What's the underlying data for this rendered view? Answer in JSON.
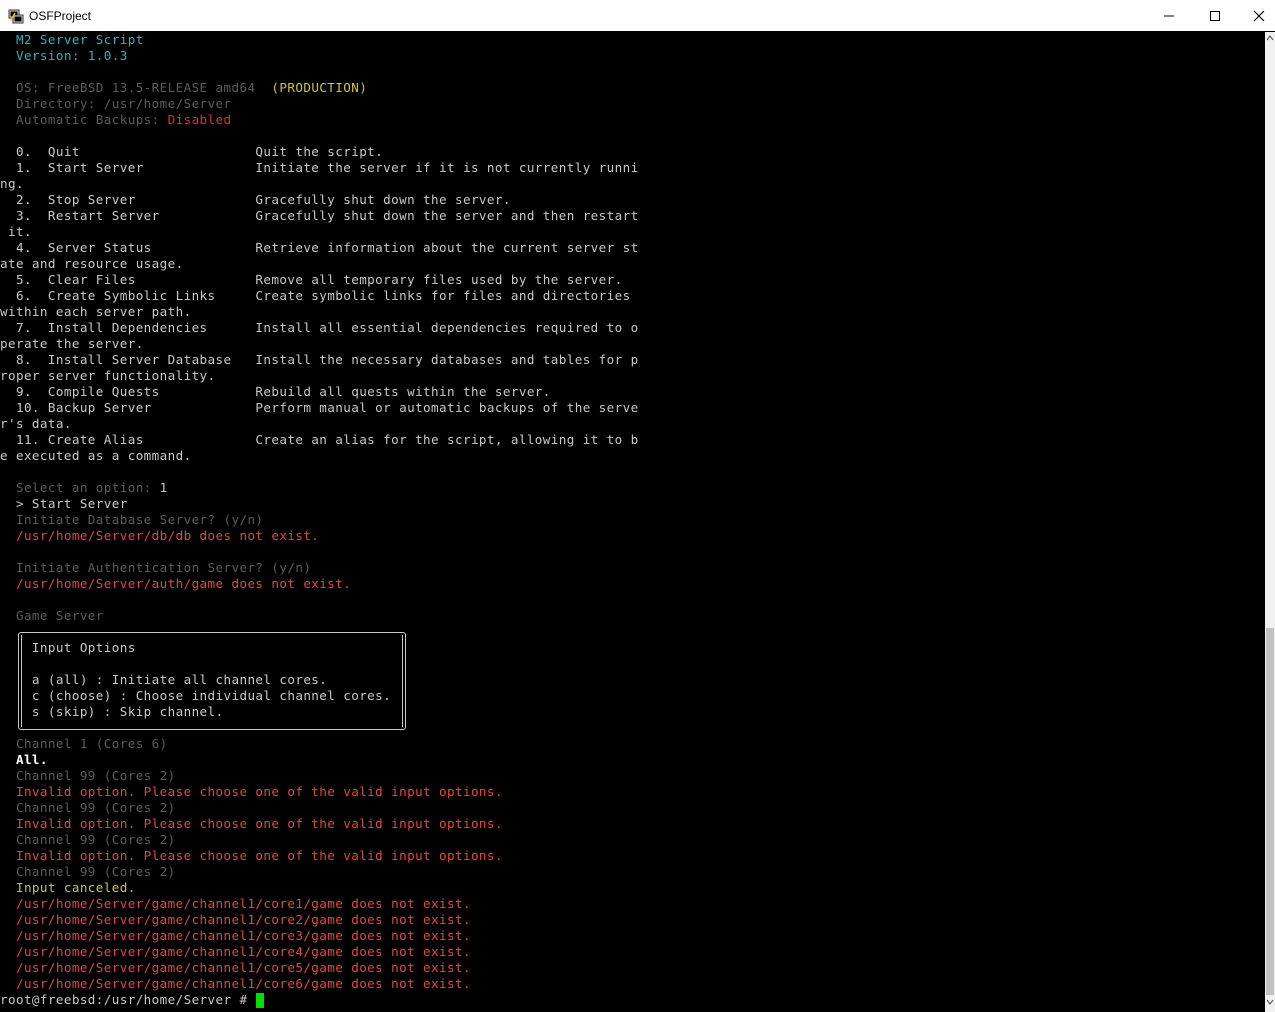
{
  "window": {
    "title": "OSFProject",
    "icon": "putty-icon",
    "controls": [
      "minimize-icon",
      "maximize-icon",
      "close-icon"
    ]
  },
  "colors": {
    "background": "#000000",
    "header": "#2ab6c0",
    "muted": "#5c5c5c",
    "error": "#e0302a",
    "warning": "#c8c83c",
    "text": "#c0c0c0",
    "cursor": "#00e000"
  },
  "terminal": {
    "header_title": "  M2 Server Script",
    "header_version": "  Version: 1.0.3",
    "os_info": "  OS: FreeBSD 13.5-RELEASE amd64",
    "os_env": "(PRODUCTION)",
    "directory": "  Directory: /usr/home/Server",
    "backups_label": "  Automatic Backups: ",
    "backups_value": "Disabled",
    "menu_lines": [
      "  0.  Quit                      Quit the script.",
      "  1.  Start Server              Initiate the server if it is not currently runni",
      "ng.",
      "  2.  Stop Server               Gracefully shut down the server.",
      "  3.  Restart Server            Gracefully shut down the server and then restart",
      " it.",
      "  4.  Server Status             Retrieve information about the current server st",
      "ate and resource usage.",
      "  5.  Clear Files               Remove all temporary files used by the server.",
      "  6.  Create Symbolic Links     Create symbolic links for files and directories",
      "within each server path.",
      "  7.  Install Dependencies      Install all essential dependencies required to o",
      "perate the server.",
      "  8.  Install Server Database   Install the necessary databases and tables for p",
      "roper server functionality.",
      "  9.  Compile Quests            Rebuild all quests within the server.",
      "  10. Backup Server             Perform manual or automatic backups of the serve",
      "r's data.",
      "  11. Create Alias              Create an alias for the script, allowing it to b",
      "e executed as a command."
    ],
    "select_prompt": "  Select an option: ",
    "select_value": "1",
    "selected_echo": "  > Start Server",
    "db_prompt": "  Initiate Database Server? (y/n)",
    "db_error": "  /usr/home/Server/db/db does not exist.",
    "auth_prompt": "  Initiate Authentication Server? (y/n)",
    "auth_error": "  /usr/home/Server/auth/game does not exist.",
    "game_server": "  Game Server",
    "input_options_title": "    Input Options",
    "input_options": [
      "    a (all) : Initiate all channel cores.",
      "    c (choose) : Choose individual channel cores.",
      "    s (skip) : Skip channel."
    ],
    "channel1": "  Channel 1 (Cores 6)",
    "all_answer": "  All.",
    "channel99": "  Channel 99 (Cores 2)",
    "invalid": "  Invalid option. Please choose one of the valid input options.",
    "canceled": "  Input canceled.",
    "core_errors": [
      "  /usr/home/Server/game/channel1/core1/game does not exist.",
      "  /usr/home/Server/game/channel1/core2/game does not exist.",
      "  /usr/home/Server/game/channel1/core3/game does not exist.",
      "  /usr/home/Server/game/channel1/core4/game does not exist.",
      "  /usr/home/Server/game/channel1/core5/game does not exist.",
      "  /usr/home/Server/game/channel1/core6/game does not exist."
    ],
    "shell_prompt": "root@freebsd:/usr/home/Server # "
  }
}
